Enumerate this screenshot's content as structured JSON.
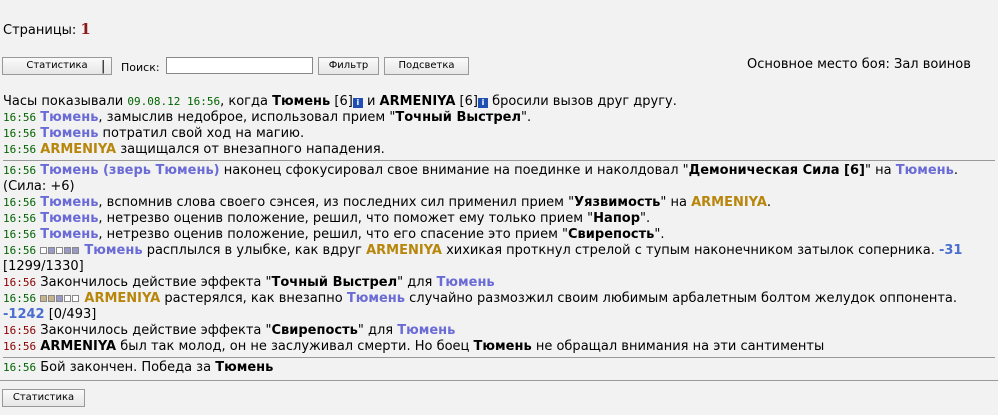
{
  "pages": {
    "label": "Страницы:",
    "current": "1"
  },
  "toolbar": {
    "stats_label": "Статистика",
    "separator": "|",
    "search_label": "Поиск:",
    "search_value": "",
    "filter_label": "Фильтр",
    "highlight_label": "Подсветка",
    "battle_place": "Основное место боя: Зал воинов"
  },
  "players": {
    "p1": "Тюмень",
    "p2": "ARMENIYA",
    "level": "[6]"
  },
  "log": {
    "l0": {
      "a": "Часы показывали ",
      "date": "09.08.12 16:56",
      "b": ", когда ",
      "c": " и ",
      "d": " бросили вызов друг другу."
    },
    "l1": {
      "time": "16:56",
      "a": ", замыслив недоброе, использовал прием \"",
      "skill": "Точный Выстрел",
      "b": "\"."
    },
    "l2": {
      "time": "16:56",
      "a": " потратил свой ход на магию."
    },
    "l3": {
      "time": "16:56",
      "a": " защищался от внезапного нападения."
    },
    "l4": {
      "time": "16:56",
      "pet": "Тюмень (зверь Тюмень)",
      "a": " наконец сфокусировал свое внимание на поединке и наколдовал \"",
      "skill": "Демоническая Сила [6]",
      "b": "\" на ",
      "c": ". (Сила: +6)"
    },
    "l5": {
      "time": "16:56",
      "a": ", вспомнив слова своего сэнсея, из последних сил применил прием \"",
      "skill": "Уязвимость",
      "b": "\" на ",
      "c": "."
    },
    "l6": {
      "time": "16:56",
      "a": ", нетрезво оценив положение, решил, что поможет ему только прием \"",
      "skill": "Напор",
      "b": "\"."
    },
    "l7": {
      "time": "16:56",
      "a": ", нетрезво оценив положение, решил, что его спасение это прием \"",
      "skill": "Свирепость",
      "b": "\"."
    },
    "l8": {
      "time": "16:56",
      "a": " расплылся в улыбке, как вдруг ",
      "b": " хихикая проткнул стрелой с тупым наконечником затылок соперника. ",
      "dmg": "-31",
      "hp": " [1299/1330]"
    },
    "l9": {
      "time": "16:56",
      "a": "Закончилось действие эффекта \"",
      "skill": "Точный Выстрел",
      "b": "\" для "
    },
    "l10": {
      "time": "16:56",
      "a": " растерялся, как внезапно ",
      "b": " случайно размозжил своим любимым арбалетным болтом желудок оппонента. ",
      "dmg": "-1242",
      "hp": " [0/493]"
    },
    "l11": {
      "time": "16:56",
      "a": "Закончилось действие эффекта \"",
      "skill": "Свирепость",
      "b": "\" для "
    },
    "l12": {
      "time": "16:56",
      "a": " был так молод, он не заслуживал смерти. Но боец ",
      "b": " не обращал внимания на эти сантименты"
    },
    "l13": {
      "time": "16:56",
      "a": "Бой закончен. Победа за "
    }
  },
  "bottom": {
    "stats_label": "Статистика"
  }
}
